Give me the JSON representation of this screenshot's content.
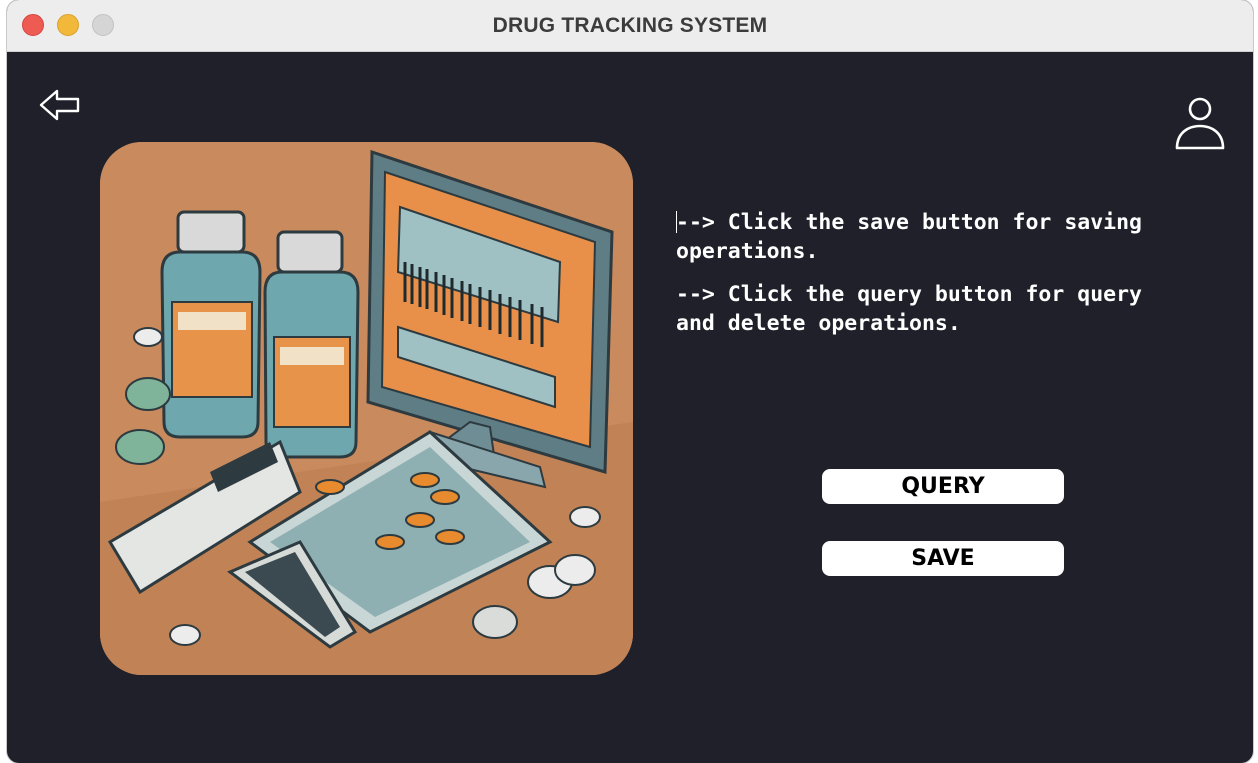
{
  "window": {
    "title": "DRUG TRACKING SYSTEM"
  },
  "nav": {
    "back_icon": "back-arrow-icon",
    "user_icon": "user-profile-icon"
  },
  "illustration": {
    "subject": "drug-tracking-illustration"
  },
  "instructions": [
    {
      "line1": "--> Click the save button for saving",
      "line2": "operations."
    },
    {
      "line1": "--> Click the query button for query",
      "line2": "and delete operations."
    }
  ],
  "buttons": {
    "query_label": "QUERY",
    "save_label": "SAVE"
  },
  "colors": {
    "background": "#1f2029",
    "titlebar": "#ededed",
    "button": "#ffffff",
    "illustration_bg": "#c98a5e"
  }
}
